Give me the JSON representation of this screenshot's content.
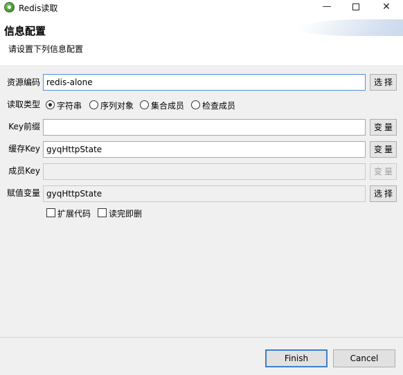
{
  "window": {
    "title": "Redis读取",
    "minimize": "—",
    "close": "✕"
  },
  "header": {
    "title": "信息配置",
    "description": "请设置下列信息配置"
  },
  "form": {
    "resource_code": {
      "label": "资源编码",
      "value": "redis-alone",
      "button": "选择"
    },
    "read_type": {
      "label": "读取类型",
      "options": [
        {
          "label": "字符串",
          "checked": true
        },
        {
          "label": "序列对象",
          "checked": false
        },
        {
          "label": "集合成员",
          "checked": false
        },
        {
          "label": "检查成员",
          "checked": false
        }
      ]
    },
    "key_prefix": {
      "label": "Key前缀",
      "value": "",
      "button": "变量"
    },
    "cache_key": {
      "label": "缓存Key",
      "value": "gyqHttpState",
      "button": "变量"
    },
    "member_key": {
      "label": "成员Key",
      "value": "",
      "button": "变量",
      "disabled": true
    },
    "assign_var": {
      "label": "赋值变量",
      "value": "gyqHttpState",
      "button": "选择"
    },
    "checkboxes": [
      {
        "label": "扩展代码",
        "checked": false
      },
      {
        "label": "读完即删",
        "checked": false
      }
    ]
  },
  "footer": {
    "finish": "Finish",
    "cancel": "Cancel"
  },
  "colors": {
    "accent": "#3d7fc9",
    "background": "#f0f0f0"
  }
}
